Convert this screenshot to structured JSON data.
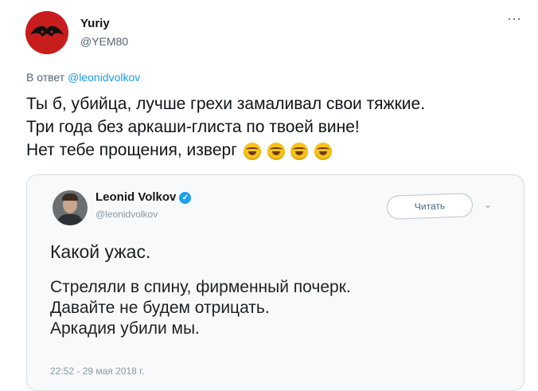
{
  "tweet": {
    "author_name": "Yuriy",
    "author_handle": "@YEM80",
    "more_label": "···",
    "reply_prefix": "В ответ",
    "reply_to": "@leonidvolkov",
    "text_lines": [
      "Ты б, убийца, лучше грехи замаливал свои тяжкие.",
      "Три года без аркаши-глиста по твоей вине!",
      "Нет тебе прощения, изверг"
    ],
    "emoji_icons": [
      "rofl-emoji",
      "rofl-emoji",
      "rofl-emoji",
      "rofl-emoji"
    ]
  },
  "quoted": {
    "author_name": "Leonid Volkov",
    "verified_mark": "✓",
    "author_handle": "@leonidvolkov",
    "follow_label": "Читать",
    "chevron": "⌄",
    "line1": "Какой ужас.",
    "lines": [
      "Стреляли в спину, фирменный почерк.",
      "Давайте не будем отрицать.",
      "Аркадия убили мы."
    ],
    "date": "22:52 - 29 мая 2018 г."
  },
  "colors": {
    "link": "#1d9bf0",
    "avatar_red": "#c81d1d",
    "verified_blue": "#1da1f2"
  }
}
